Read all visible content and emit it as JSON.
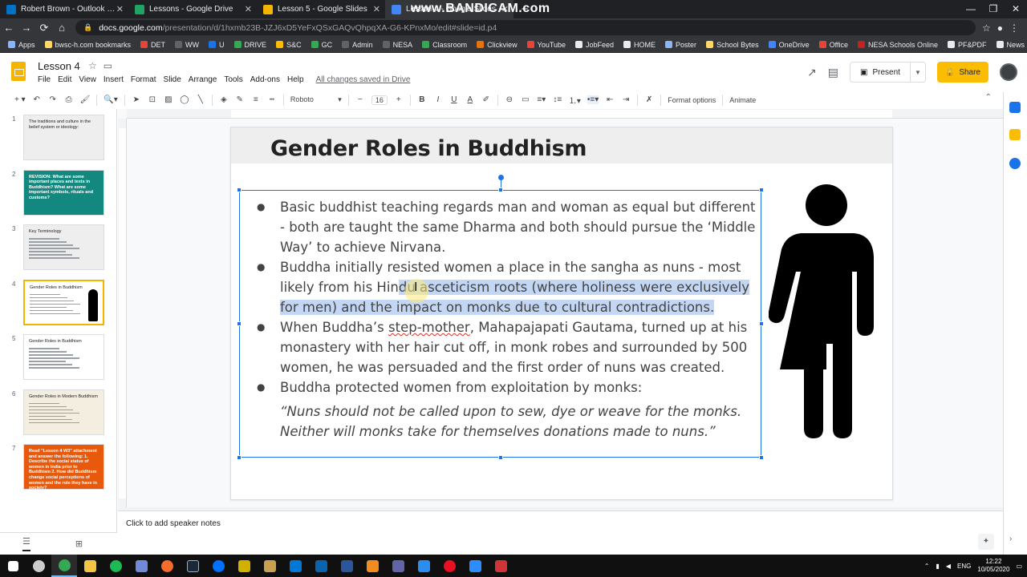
{
  "browser": {
    "tabs": [
      {
        "title": "Robert Brown - Outlook Web App",
        "color": "#0072c6"
      },
      {
        "title": "Lessons - Google Drive",
        "color": "#1fa463"
      },
      {
        "title": "Lesson 5 - Google Slides",
        "color": "#f4b400"
      },
      {
        "title": "Lesson 4 - Google Slides",
        "color": "#4285f4",
        "active": true
      }
    ],
    "watermark": "www.BANDICAM.com",
    "new_tab": "+",
    "url_host": "docs.google.com",
    "url_path": "/presentation/d/1hxmb23B-JZJ6xD5YeFxQSxGAQvQhpqXA-G6-KPnxMo/edit#slide=id.p4",
    "bookmarks": [
      {
        "label": "Apps",
        "color": "#8ab4f8"
      },
      {
        "label": "bwsc-h.com bookmarks",
        "color": "#fdd663"
      },
      {
        "label": "DET",
        "color": "#ea4335"
      },
      {
        "label": "WW",
        "color": "#5f6368"
      },
      {
        "label": "U",
        "color": "#1a73e8"
      },
      {
        "label": "DRIVE",
        "color": "#34a853"
      },
      {
        "label": "S&C",
        "color": "#fbbc04"
      },
      {
        "label": "GC",
        "color": "#34a853"
      },
      {
        "label": "Admin",
        "color": "#5f6368"
      },
      {
        "label": "NESA",
        "color": "#5f6368"
      },
      {
        "label": "Classroom",
        "color": "#34a853"
      },
      {
        "label": "Clickview",
        "color": "#e8710a"
      },
      {
        "label": "YouTube",
        "color": "#ea4335"
      },
      {
        "label": "JobFeed",
        "color": "#e8eaed"
      },
      {
        "label": "HOME",
        "color": "#e8eaed"
      },
      {
        "label": "Poster",
        "color": "#8ab4f8"
      },
      {
        "label": "School Bytes",
        "color": "#fdd663"
      },
      {
        "label": "OneDrive",
        "color": "#4285f4"
      },
      {
        "label": "Office",
        "color": "#ea4335"
      },
      {
        "label": "NESA Schools Online",
        "color": "#c5221f"
      },
      {
        "label": "PF&PDF",
        "color": "#e8eaed"
      },
      {
        "label": "News",
        "color": "#e8eaed"
      }
    ],
    "bookmarks_more": "»"
  },
  "slides": {
    "doc_title": "Lesson 4",
    "menu": [
      "File",
      "Edit",
      "View",
      "Insert",
      "Format",
      "Slide",
      "Arrange",
      "Tools",
      "Add-ons",
      "Help"
    ],
    "saved_status": "All changes saved in Drive",
    "present_label": "Present",
    "share_label": "Share",
    "toolbar": {
      "font": "Roboto",
      "font_size": "16",
      "format_options": "Format options",
      "animate": "Animate"
    },
    "speaker_notes_placeholder": "Click to add speaker notes",
    "accent": "#f4b400",
    "selection_color": "#1a73e8"
  },
  "thumbnails": [
    {
      "num": "1",
      "text": "The traditions and culture in the belief system or ideology:",
      "bg": "#eeeeee",
      "light": false
    },
    {
      "num": "2",
      "text": "REVISION: What are some important places and texts in Buddhism? What are some important symbols, rituals and customs?",
      "bg": "#12887f",
      "light": true
    },
    {
      "num": "3",
      "text": "Key Terminology",
      "bg": "#eeeeee",
      "light": false
    },
    {
      "num": "4",
      "text": "Gender Roles in Buddhism",
      "bg": "#ffffff",
      "light": false,
      "selected": true
    },
    {
      "num": "5",
      "text": "Gender Roles in Buddhism",
      "bg": "#ffffff",
      "light": false
    },
    {
      "num": "6",
      "text": "Gender Roles in Modern Buddhism",
      "bg": "#f3eee0",
      "light": false
    },
    {
      "num": "7",
      "text": "Read \"Lesson 4 W3\" attachment and answer the following: 1. Describe the social status of women in India prior to Buddhism 2. How did Buddhism change social perceptions of women and the role they have in society?",
      "bg": "#e8590c",
      "light": true
    }
  ],
  "slide": {
    "title": "Gender Roles in Buddhism",
    "bullets": {
      "b1": "Basic buddhist teaching regards man and woman as equal but different - both are taught the same Dharma and both should pursue the ‘Middle Way’ to achieve Nirvana.",
      "b2_pre": "Buddha initially resisted women a place in the sangha as nuns - most likely from his Hin",
      "b2_hl": "du asceticism roots (where holiness were exclusively for men) and the impact on monks due to cultural contradictions.",
      "b3_pre": "When Buddha’s ",
      "b3_word": "step-mother",
      "b3_post": ", Mahapajapati Gautama, turned up at his monastery with her hair cut off, in monk robes and surrounded by 500 women, he was persuaded and the first order of nuns was created.",
      "b4": "Buddha protected women from exploitation by monks:"
    },
    "quote": "“Nuns should not be called upon to sew, dye or weave for the monks. Neither will monks take for themselves donations made to nuns.”",
    "figure_icon": "gender-figure-icon"
  },
  "taskbar": {
    "lang": "ENG",
    "time": "12:22",
    "date": "10/05/2020"
  }
}
